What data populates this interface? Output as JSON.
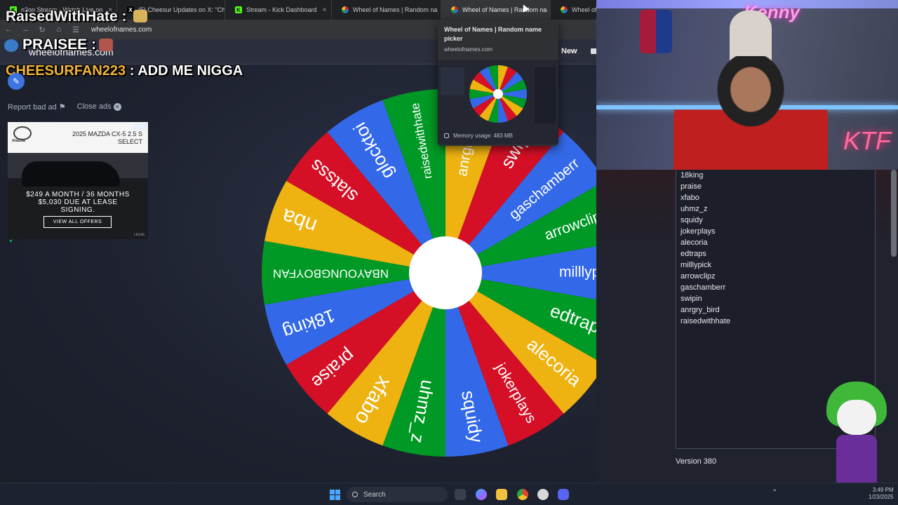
{
  "browser": {
    "tabs": [
      {
        "label": "n3on Stream - Watch Live on",
        "icon": "kick-favicon",
        "active": false
      },
      {
        "label": "(5) Cheesur Updates on X: \"Ch",
        "icon": "x-favicon",
        "active": false
      },
      {
        "label": "Stream - Kick Dashboard",
        "icon": "kick-favicon",
        "active": false
      },
      {
        "label": "Wheel of Names | Random na",
        "icon": "wheel-favicon",
        "active": false
      },
      {
        "label": "Wheel of Names | Random na",
        "icon": "wheel-favicon",
        "active": true
      },
      {
        "label": "Wheel of N",
        "icon": "wheel-favicon",
        "active": false
      }
    ],
    "url": "wheelofnames.com",
    "close_glyph": "×"
  },
  "overlay": {
    "raised_text": "RaisedWithHate :",
    "praisee_text": "PRAISEE :",
    "chat_name": "CHEESURFAN223",
    "chat_message": ": ADD ME NIGGA"
  },
  "site": {
    "brand": "wheelofnames.com",
    "new_label": "New"
  },
  "ad": {
    "report_label": "Report bad ad",
    "close_label": "Close ads",
    "brand": "mazda",
    "model_line1": "2025 MAZDA CX-5 2.5 S",
    "model_line2": "SELECT",
    "offer_line1": "$249 A MONTH / 36 MONTHS",
    "offer_line2": "$5,030 DUE AT LEASE",
    "offer_line3": "SIGNING.",
    "button_label": "VIEW ALL OFFERS",
    "legal": "LEGAL"
  },
  "wheel": {
    "colors": [
      "#3369e8",
      "#009925",
      "#eeb211",
      "#d50f25"
    ],
    "segments": [
      "milllypick",
      "edtraps",
      "alecoria",
      "jokerplays",
      "squidy",
      "uhmz_z",
      "xfabo",
      "praise",
      "18king",
      "NBAYOUNGBOYFAN",
      "nba",
      "slatsss",
      "glocktoi",
      "raisedwithhate",
      "anrgry_bird",
      "swipin",
      "gaschamberr",
      "arrowclipz"
    ]
  },
  "tab_preview": {
    "title": "Wheel of Names | Random name picker",
    "url": "wheelofnames.com",
    "memory": "Memory usage: 483 MB"
  },
  "entries": {
    "items": [
      "18king",
      "praise",
      "xfabo",
      "uhmz_z",
      "squidy",
      "jokerplays",
      "alecoria",
      "edtraps",
      "milllypick",
      "arrowclipz",
      "gaschamberr",
      "swipin",
      "anrgry_bird",
      "raisedwithhate"
    ]
  },
  "version_label": "Version 380",
  "webcam": {
    "neon_sign": "Kenny",
    "wall_text": "KTF"
  },
  "taskbar": {
    "search_label": "Search",
    "time": "3:49 PM",
    "date": "1/23/2025"
  }
}
